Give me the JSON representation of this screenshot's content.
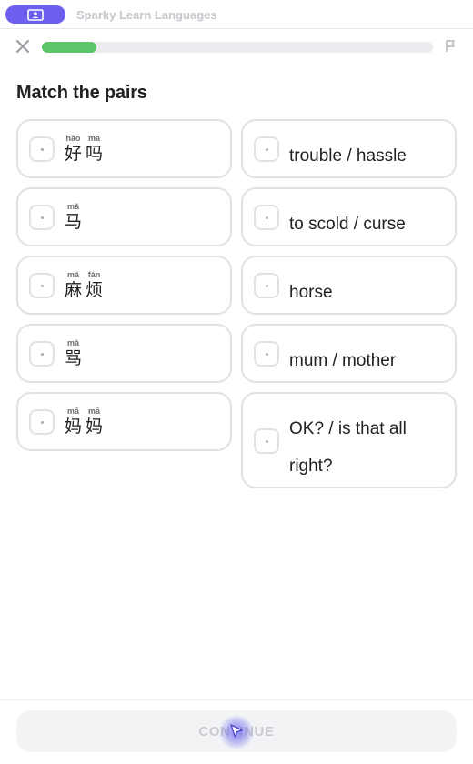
{
  "app": {
    "title": "Sparky Learn Languages",
    "icon": "screen-share-icon"
  },
  "progress": {
    "value": 0.14
  },
  "lesson": {
    "prompt": "Match the pairs"
  },
  "left_cards": [
    {
      "syllables": [
        {
          "pinyin": "hǎo",
          "hanzi": "好"
        },
        {
          "pinyin": "ma",
          "hanzi": "吗"
        }
      ]
    },
    {
      "syllables": [
        {
          "pinyin": "mǎ",
          "hanzi": "马"
        }
      ]
    },
    {
      "syllables": [
        {
          "pinyin": "má",
          "hanzi": "麻"
        },
        {
          "pinyin": "fán",
          "hanzi": "烦"
        }
      ]
    },
    {
      "syllables": [
        {
          "pinyin": "mà",
          "hanzi": "骂"
        }
      ]
    },
    {
      "syllables": [
        {
          "pinyin": "mā",
          "hanzi": "妈"
        },
        {
          "pinyin": "mā",
          "hanzi": "妈"
        }
      ]
    }
  ],
  "right_cards": [
    {
      "text": "trouble / hassle"
    },
    {
      "text": "to scold / curse"
    },
    {
      "text": "horse"
    },
    {
      "text": "mum / mother"
    },
    {
      "text": "OK? / is that all right?"
    }
  ],
  "footer": {
    "continue_label": "CONTINUE"
  },
  "colors": {
    "accent": "#6d5ff0",
    "progress": "#5bc56a",
    "border": "#e2e2e6"
  }
}
